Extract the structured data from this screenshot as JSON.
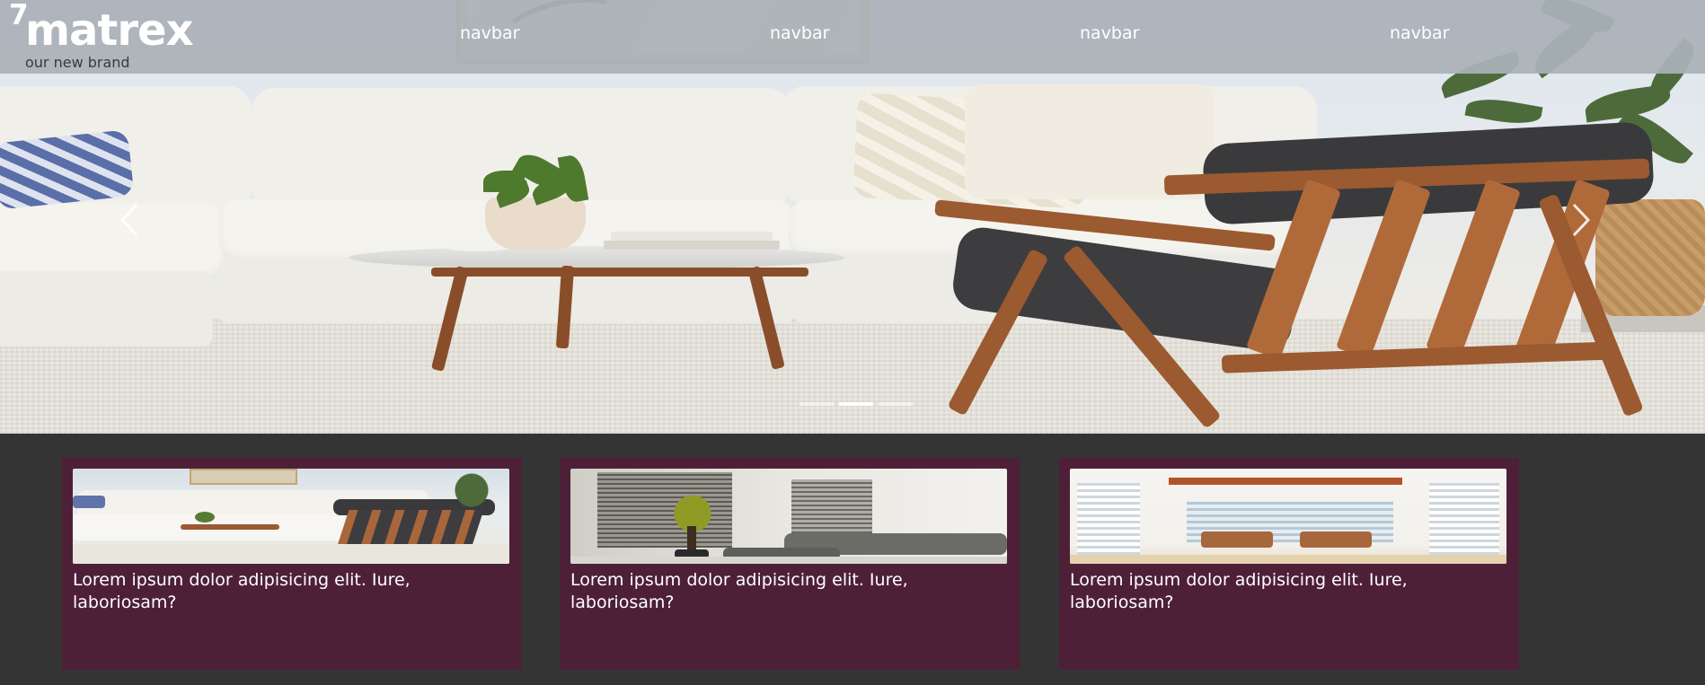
{
  "navbar": {
    "brand": {
      "superscript": "7",
      "name": "matrex",
      "tagline": "our new brand"
    },
    "links": [
      "navbar",
      "navbar",
      "navbar",
      "navbar"
    ]
  },
  "carousel": {
    "slide_count": 3,
    "active_slide": 2,
    "prev_icon": "chevron-left-icon",
    "next_icon": "chevron-right-icon"
  },
  "cards": [
    {
      "text": "Lorem ipsum dolor adipisicing elit. Iure, laboriosam?"
    },
    {
      "text": "Lorem ipsum dolor adipisicing elit. Iure, laboriosam?"
    },
    {
      "text": "Lorem ipsum dolor adipisicing elit. Iure, laboriosam?"
    }
  ],
  "colors": {
    "navbar_bg": "#aab2b8",
    "page_bg": "#343434",
    "card_bg": "#4e2038",
    "text": "#ffffff"
  }
}
